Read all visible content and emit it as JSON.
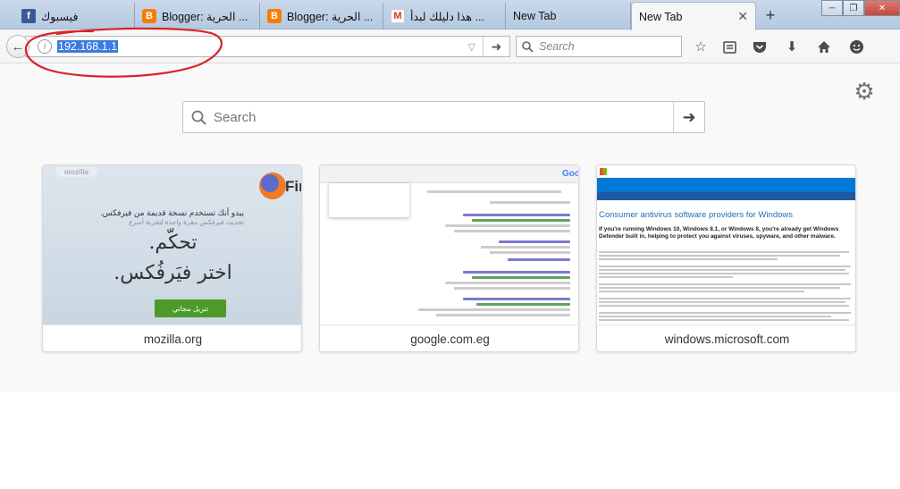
{
  "tabs": [
    {
      "title": "فيسبوك",
      "favicon": "facebook-icon"
    },
    {
      "title": "Blogger: الحرية ...",
      "favicon": "blogger-icon"
    },
    {
      "title": "Blogger: الحرية ...",
      "favicon": "blogger-icon"
    },
    {
      "title": "هذا دليلك لبدأ ...",
      "favicon": "gmail-icon"
    },
    {
      "title": "New Tab",
      "favicon": ""
    },
    {
      "title": "New Tab",
      "favicon": "",
      "active": true
    }
  ],
  "tab_close_glyph": "✕",
  "new_tab_glyph": "+",
  "window_controls": {
    "minimize": "─",
    "restore": "❐",
    "close": "✕"
  },
  "navbar": {
    "url": "192.168.1.1",
    "search_placeholder": "Search"
  },
  "newtab_page": {
    "search_placeholder": "Search"
  },
  "tiles": [
    {
      "caption": "mozilla.org",
      "thumb_tag": "mozilla",
      "brand": "Fir",
      "warning": "يبدو أنك تستخدم نسخة قديمة من فيرفكس.",
      "warning_sub": "تحديث فيرفكس بنقرة واحدة لتجربة أسرع",
      "headline1": "تحكّم.",
      "headline2": "اختر فيَرفُكس.",
      "button": "تنزيل مجاني"
    },
    {
      "caption": "google.com.eg",
      "logo": "Goo"
    },
    {
      "caption": "windows.microsoft.com",
      "title": "Consumer antivirus software providers for Windows",
      "bold": "If you're running Windows 10, Windows 8.1, or Windows 8, you're already get Windows Defender built in, helping to protect you against viruses, spyware, and other malware."
    }
  ],
  "colors": {
    "url_highlight": "#3b7be0",
    "annotation": "#d8242b",
    "firefox_button": "#4c9a2a",
    "microsoft_blue": "#0078d7"
  }
}
